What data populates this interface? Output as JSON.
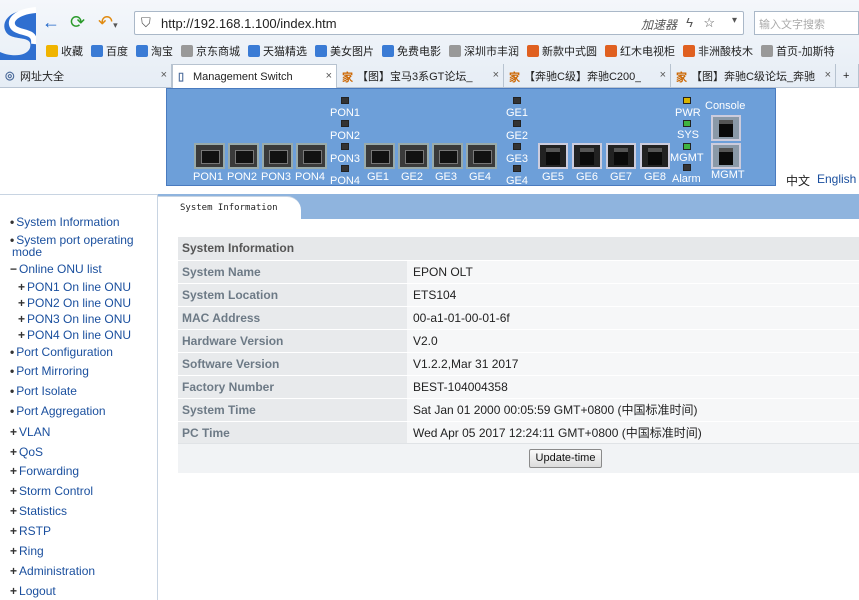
{
  "browser": {
    "url": "http://192.168.1.100/index.htm",
    "accelerator": "加速器",
    "search_placeholder": "输入文字搜索",
    "bookmarks": [
      "收藏",
      "百度",
      "淘宝",
      "京东商城",
      "天猫精选",
      "美女图片",
      "免费电影",
      "深圳市丰润",
      "新款中式圆",
      "红木电视柜",
      "非洲酸枝木",
      "首页-加斯特"
    ],
    "tabs": [
      "网址大全",
      "Management Switch",
      "【图】宝马3系GT论坛_",
      "【奔驰C级】奔驰C200_",
      "【图】奔驰C级论坛_奔驰"
    ],
    "new_tab": "+"
  },
  "device": {
    "pon_ports": [
      "PON1",
      "PON2",
      "PON3",
      "PON4"
    ],
    "ge_sfp_ports": [
      "GE1",
      "GE2",
      "GE3",
      "GE4"
    ],
    "ge_rj_ports": [
      "GE5",
      "GE6",
      "GE7",
      "GE8"
    ],
    "pon_leds": [
      "PON1",
      "PON2",
      "PON3",
      "PON4"
    ],
    "ge_leds": [
      "GE1",
      "GE2",
      "GE3",
      "GE4"
    ],
    "status_leds": [
      "PWR",
      "SYS",
      "MGMT",
      "Alarm"
    ],
    "console": "Console",
    "mgmt": "MGMT"
  },
  "languages": [
    "中文",
    "English"
  ],
  "sidebar": {
    "items": [
      {
        "marker": "•",
        "label": "System Information"
      },
      {
        "marker": "•",
        "label": "System port operating"
      },
      {
        "marker": "",
        "label": "mode"
      },
      {
        "marker": "−",
        "label": "Online ONU list"
      },
      {
        "marker": "+",
        "label": "PON1 On line ONU"
      },
      {
        "marker": "+",
        "label": "PON2 On line ONU"
      },
      {
        "marker": "+",
        "label": "PON3 On line ONU"
      },
      {
        "marker": "+",
        "label": "PON4 On line ONU"
      },
      {
        "marker": "•",
        "label": "Port Configuration"
      },
      {
        "marker": "•",
        "label": "Port Mirroring"
      },
      {
        "marker": "•",
        "label": "Port Isolate"
      },
      {
        "marker": "•",
        "label": "Port Aggregation"
      },
      {
        "marker": "+",
        "label": "VLAN"
      },
      {
        "marker": "+",
        "label": "QoS"
      },
      {
        "marker": "+",
        "label": "Forwarding"
      },
      {
        "marker": "+",
        "label": "Storm Control"
      },
      {
        "marker": "+",
        "label": "Statistics"
      },
      {
        "marker": "+",
        "label": "RSTP"
      },
      {
        "marker": "+",
        "label": "Ring"
      },
      {
        "marker": "+",
        "label": "Administration"
      },
      {
        "marker": "+",
        "label": "Logout"
      }
    ]
  },
  "main": {
    "tab_label": "System Information",
    "table_title": "System Information",
    "rows": [
      {
        "label": "System Name",
        "value": "EPON OLT"
      },
      {
        "label": "System Location",
        "value": "ETS104"
      },
      {
        "label": "MAC Address",
        "value": "00-a1-01-00-01-6f"
      },
      {
        "label": "Hardware Version",
        "value": "V2.0"
      },
      {
        "label": "Software Version",
        "value": "V1.2.2,Mar 31 2017"
      },
      {
        "label": "Factory Number",
        "value": "BEST-104004358"
      },
      {
        "label": "System Time",
        "value": "Sat Jan 01 2000 00:05:59 GMT+0800 (中国标准时间)"
      },
      {
        "label": "PC Time",
        "value": "Wed Apr 05 2017 12:24:11 GMT+0800 (中国标准时间)"
      }
    ],
    "update_button": "Update-time"
  }
}
